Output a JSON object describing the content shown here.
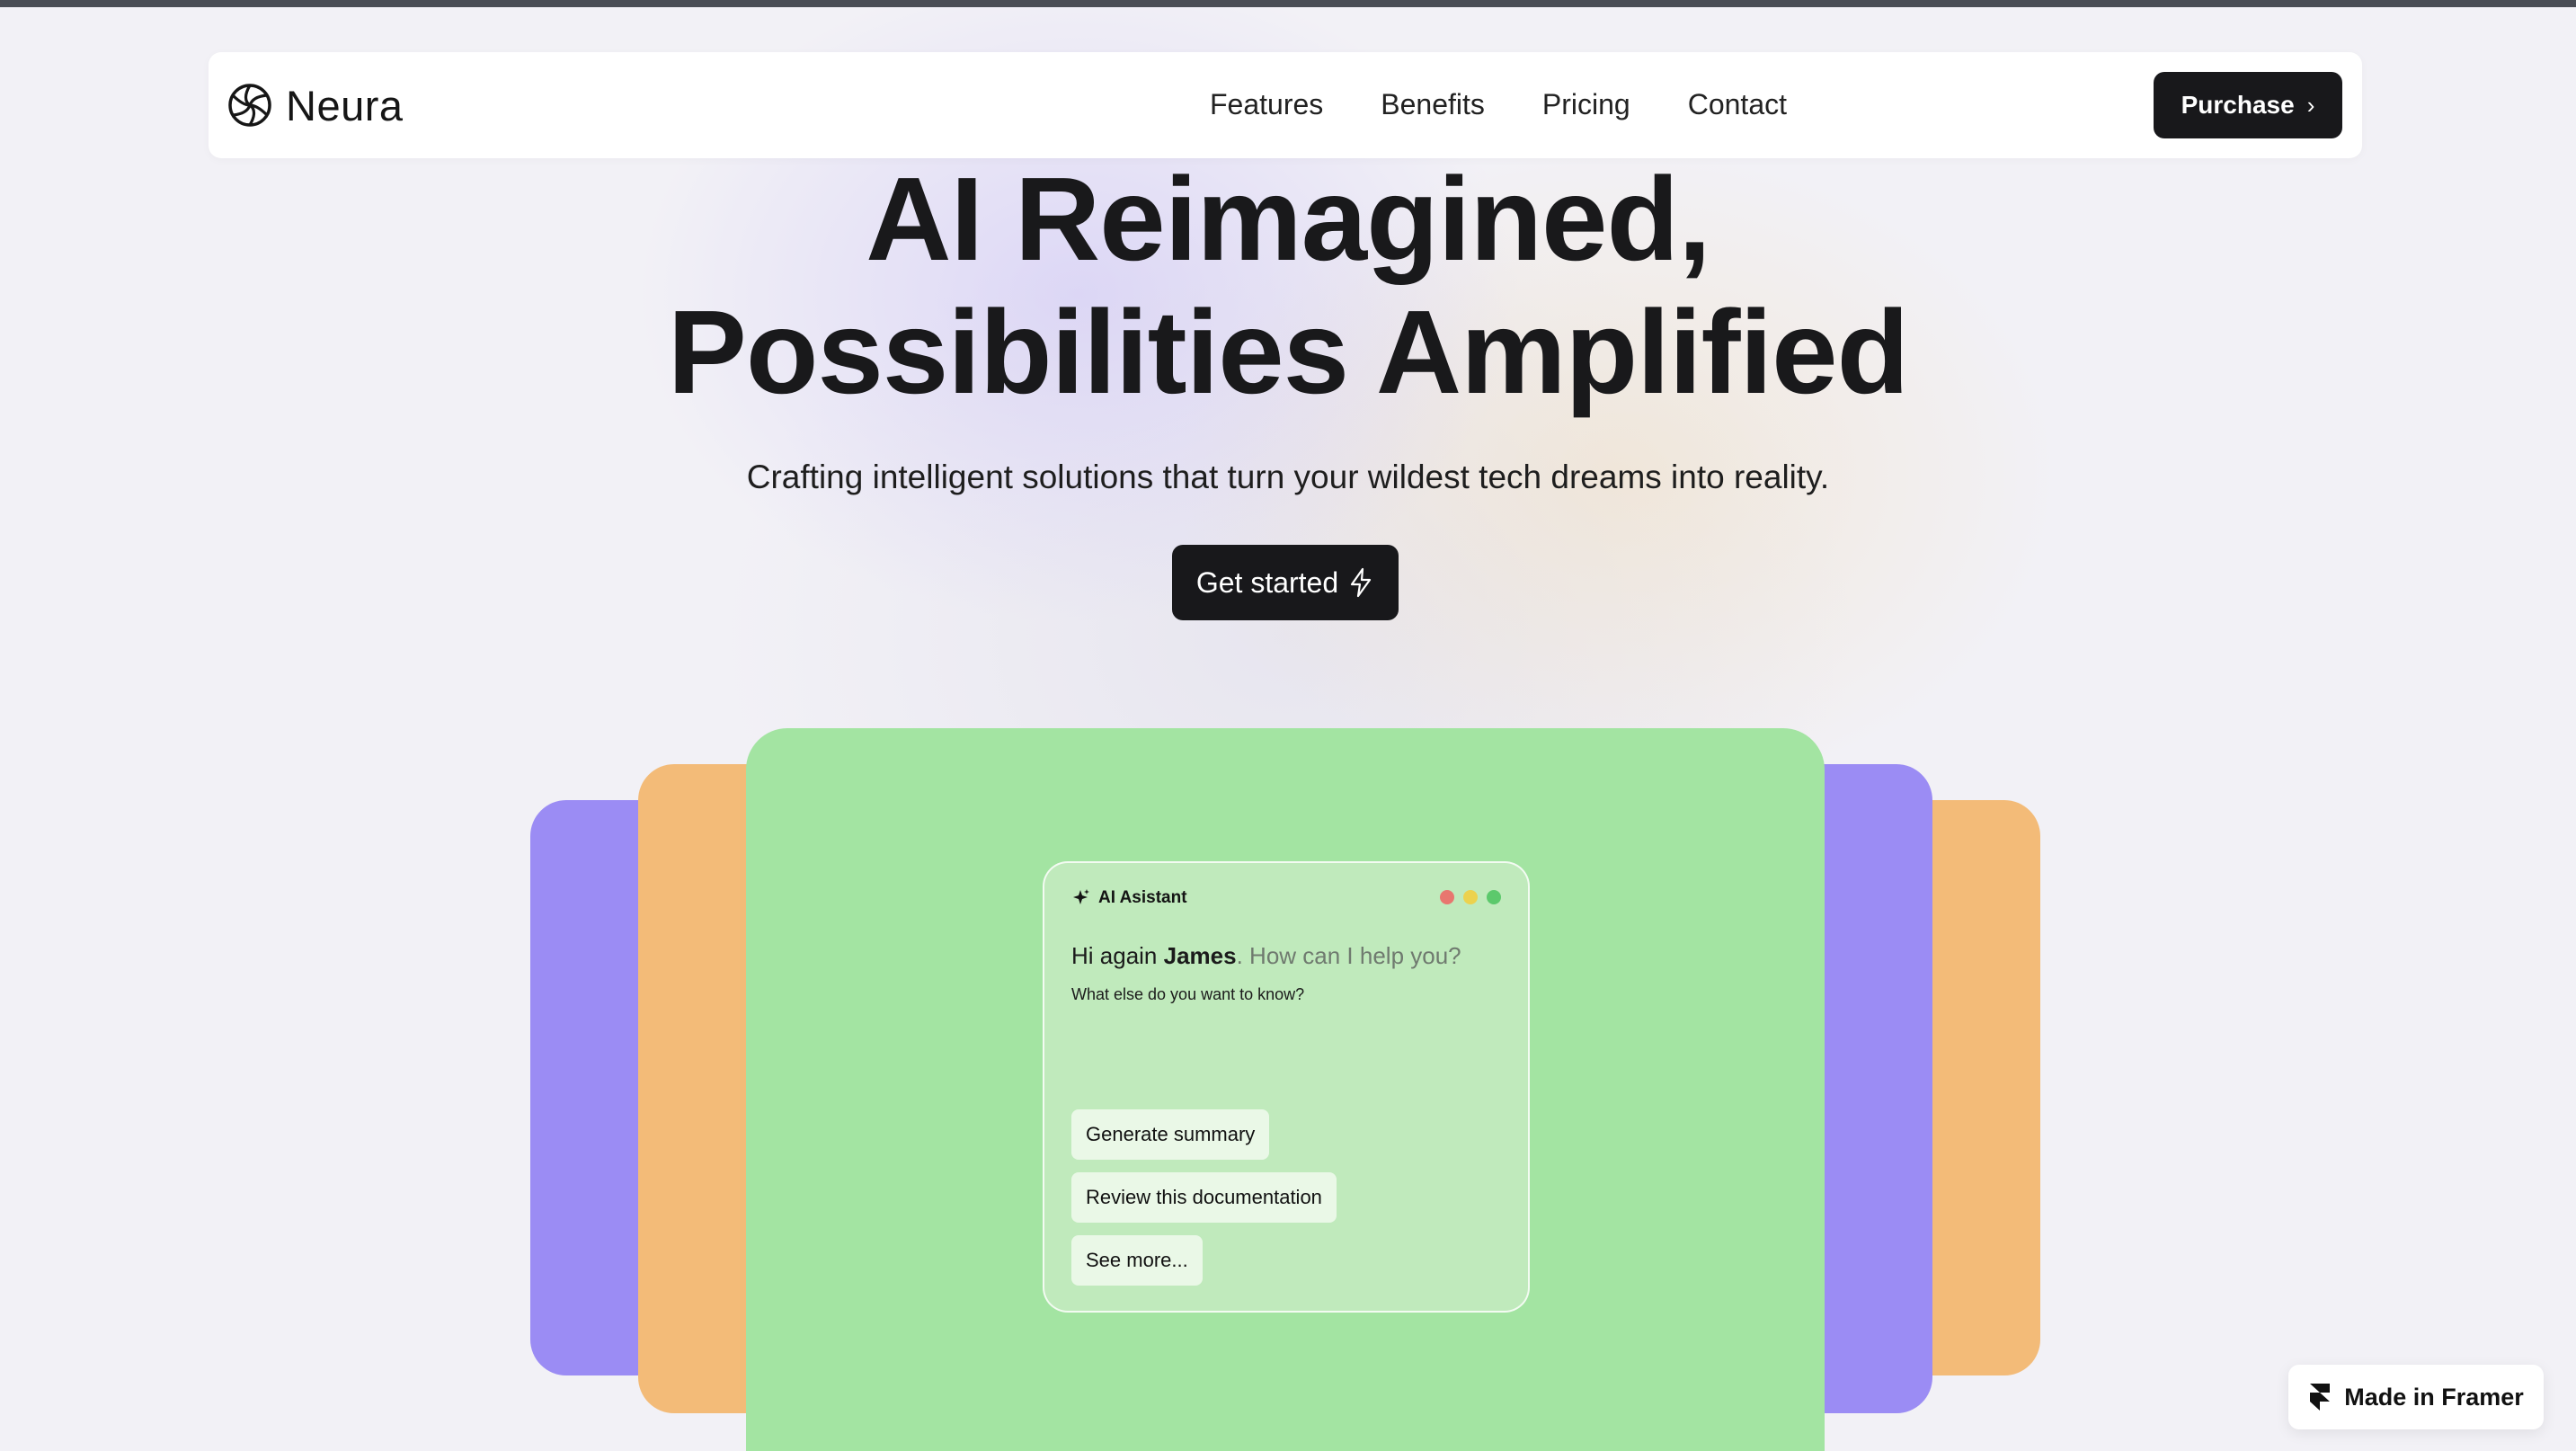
{
  "nav": {
    "brand": "Neura",
    "logo_icon": "aperture-icon",
    "links": [
      "Features",
      "Benefits",
      "Pricing",
      "Contact"
    ],
    "purchase_label": "Purchase",
    "purchase_icon": "chevron-right-icon"
  },
  "hero": {
    "title_line1": "AI Reimagined,",
    "title_line2": "Possibilities Amplified",
    "subtitle": "Crafting intelligent solutions that turn your wildest tech dreams into reality.",
    "cta_label": "Get started",
    "cta_icon": "lightning-icon"
  },
  "assistant": {
    "title": "AI Asistant",
    "title_icon": "sparkle-icon",
    "greeting_prefix": "Hi again ",
    "greeting_name": "James",
    "greeting_suffix": ". How can I help you?",
    "question": "What else do you want to know?",
    "chips": [
      "Generate summary",
      "Review this documentation",
      "See more..."
    ],
    "window_dots": [
      "#e8776f",
      "#ecd24e",
      "#5cc96c"
    ]
  },
  "cards": {
    "purple": "#9b8cf4",
    "orange": "#f3bb78",
    "green": "#a3e4a2"
  },
  "badge": {
    "label": "Made in Framer",
    "icon": "framer-icon"
  }
}
